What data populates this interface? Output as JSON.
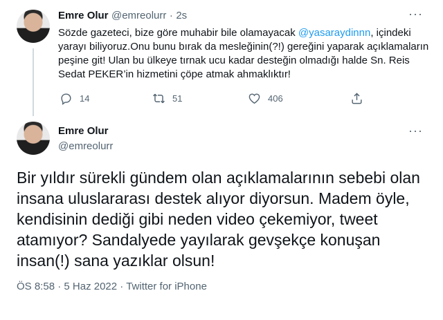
{
  "tweet1": {
    "author_name": "Emre Olur",
    "handle": "@emreolurr",
    "separator": "·",
    "time": "2s",
    "more": "···",
    "text_before": "Sözde gazeteci, bize göre muhabir bile olamayacak ",
    "mention": "@yasaraydinnn",
    "text_after": ", içindeki yarayı biliyoruz.Onu bunu bırak da mesleğinin(?!) gereğini yaparak açıklamaların peşine git! Ulan bu ülkeye tırnak ucu kadar desteğin olmadığı halde Sn. Reis Sedat PEKER’in hizmetini çöpe atmak ahmaklıktır!",
    "actions": {
      "reply_count": "14",
      "retweet_count": "51",
      "like_count": "406"
    }
  },
  "tweet2": {
    "author_name": "Emre Olur",
    "handle": "@emreolurr",
    "more": "···",
    "text": "Bir yıldır sürekli gündem olan açıklamalarının sebebi olan insana uluslararası destek alıyor diyorsun. Madem öyle, kendisinin dediği gibi neden video çekemiyor, tweet atamıyor? Sandalyede yayılarak gevşekçe konuşan insan(!) sana yazıklar olsun!",
    "time": "ÖS 8:58",
    "dot": "·",
    "date": "5 Haz 2022",
    "source": "Twitter for iPhone"
  },
  "icons": [
    "reply-icon",
    "retweet-icon",
    "like-icon",
    "share-icon",
    "more-icon"
  ],
  "colors": {
    "link": "#1d9bf0",
    "muted": "#536471",
    "text": "#0f1419",
    "thread_line": "#cfd9de"
  }
}
